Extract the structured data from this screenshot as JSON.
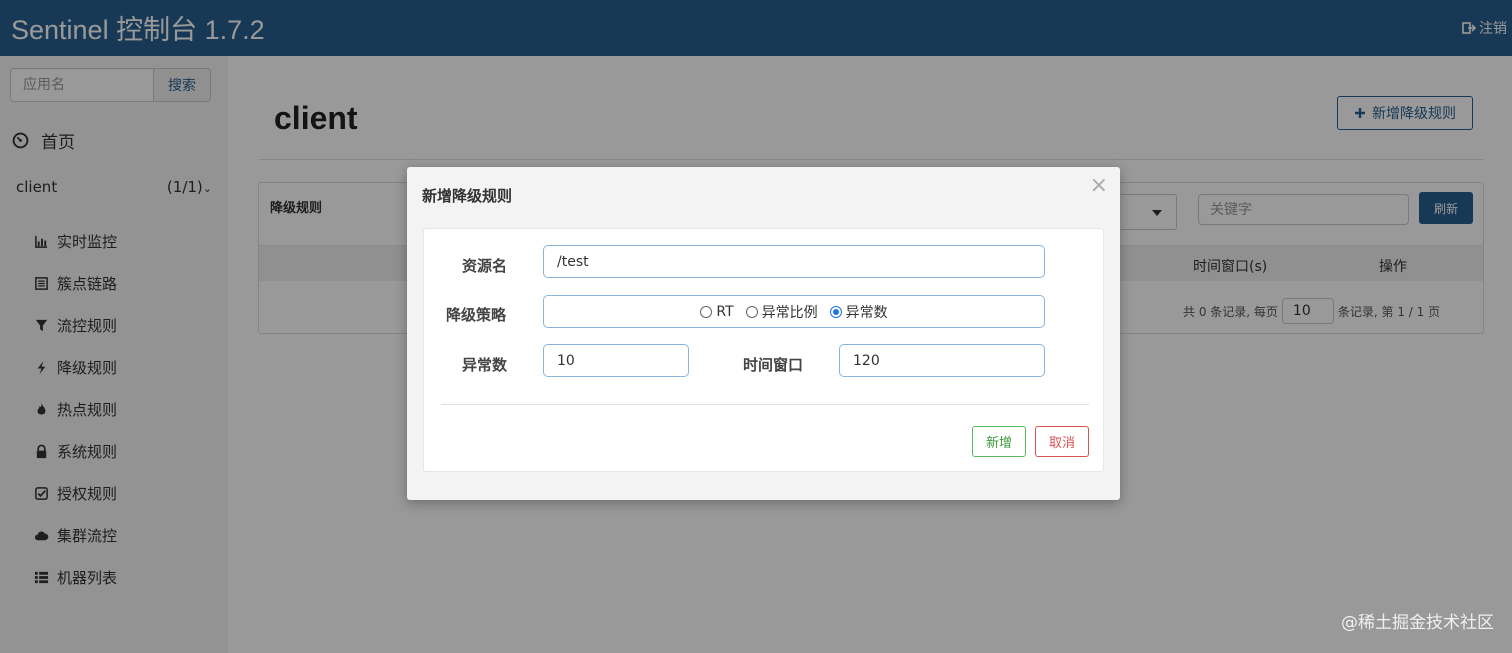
{
  "header": {
    "brand": "Sentinel 控制台 1.7.2",
    "logout_label": "注销"
  },
  "sidebar": {
    "search_placeholder": "应用名",
    "search_button": "搜索",
    "home_label": "首页",
    "app": {
      "name": "client",
      "count": "(1/1)"
    },
    "items": [
      {
        "label": "实时监控",
        "icon": "bar-chart-icon"
      },
      {
        "label": "簇点链路",
        "icon": "list-alt-icon"
      },
      {
        "label": "流控规则",
        "icon": "filter-icon"
      },
      {
        "label": "降级规则",
        "icon": "flash-icon"
      },
      {
        "label": "热点规则",
        "icon": "fire-icon"
      },
      {
        "label": "系统规则",
        "icon": "lock-icon"
      },
      {
        "label": "授权规则",
        "icon": "check-icon"
      },
      {
        "label": "集群流控",
        "icon": "cloud-icon"
      },
      {
        "label": "机器列表",
        "icon": "th-list-icon"
      }
    ]
  },
  "main": {
    "title": "client",
    "add_rule_button": "新增降级规则",
    "panel": {
      "title": "降级规则",
      "keyword_placeholder": "关键字",
      "refresh_button": "刷新",
      "columns": {
        "time_window": "时间窗口(s)",
        "ops": "操作"
      },
      "pager": {
        "prefix": "共 0 条记录, 每页",
        "page_size": "10",
        "suffix": "条记录, 第 1 / 1 页"
      }
    }
  },
  "modal": {
    "title": "新增降级规则",
    "close": "×",
    "resource_label": "资源名",
    "resource_value": "/test",
    "strategy_label": "降级策略",
    "options": [
      "RT",
      "异常比例",
      "异常数"
    ],
    "selected_option": "异常数",
    "count_label": "异常数",
    "count_value": "10",
    "window_label": "时间窗口",
    "window_value": "120",
    "ok_button": "新增",
    "cancel_button": "取消"
  },
  "watermark": "@稀土掘金技术社区",
  "colors": {
    "brand": "#286090",
    "success": "#5cb85c",
    "danger": "#d9534f",
    "radio": "#1a73e8"
  }
}
